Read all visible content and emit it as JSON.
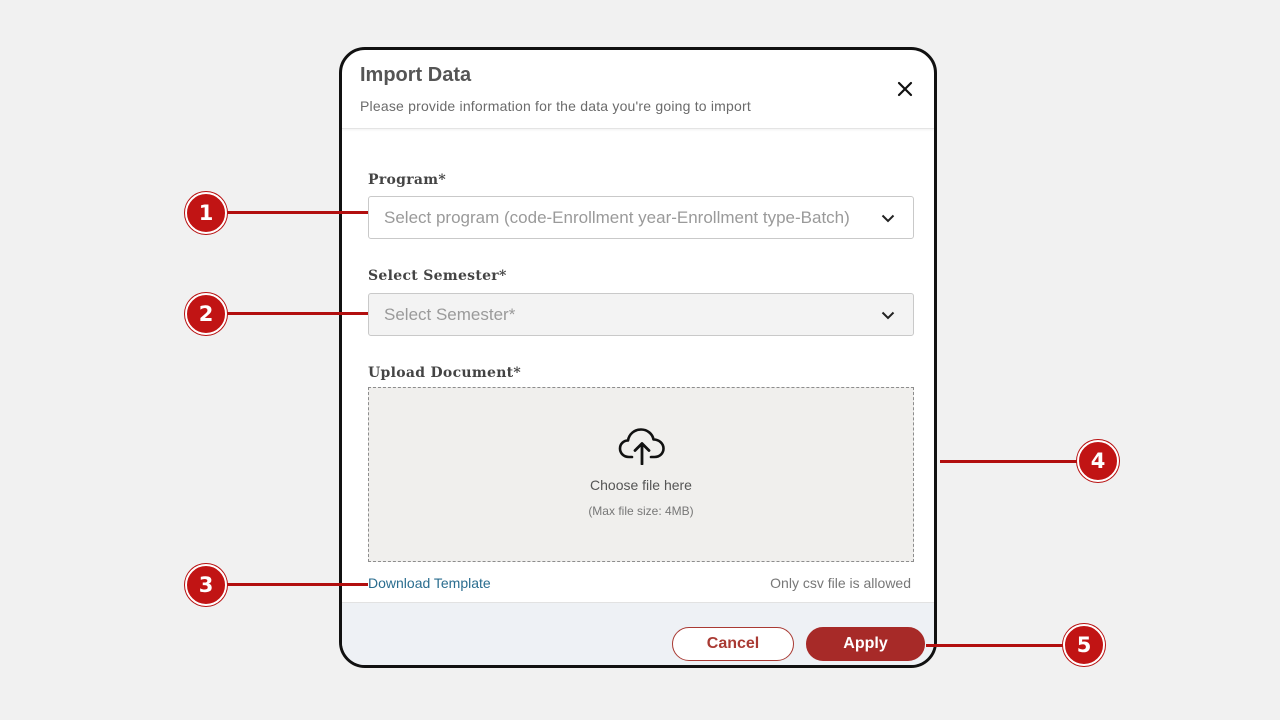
{
  "modal": {
    "title": "Import Data",
    "subtitle": "Please provide information for the data you're going to import"
  },
  "fields": {
    "program": {
      "label": "Program*",
      "placeholder": "Select program (code-Enrollment year-Enrollment type-Batch)"
    },
    "semester": {
      "label": "Select Semester*",
      "placeholder": "Select Semester*"
    },
    "upload": {
      "label": "Upload Document*",
      "prompt": "Choose file here",
      "hint": "(Max file size: 4MB)"
    }
  },
  "links": {
    "download_template": "Download Template",
    "csv_note": "Only csv file is allowed"
  },
  "buttons": {
    "cancel": "Cancel",
    "apply": "Apply"
  },
  "callouts": [
    "1",
    "2",
    "3",
    "4",
    "5"
  ],
  "colors": {
    "accent": "#a72a28",
    "callout": "#c11414",
    "link": "#2a6d8f"
  }
}
